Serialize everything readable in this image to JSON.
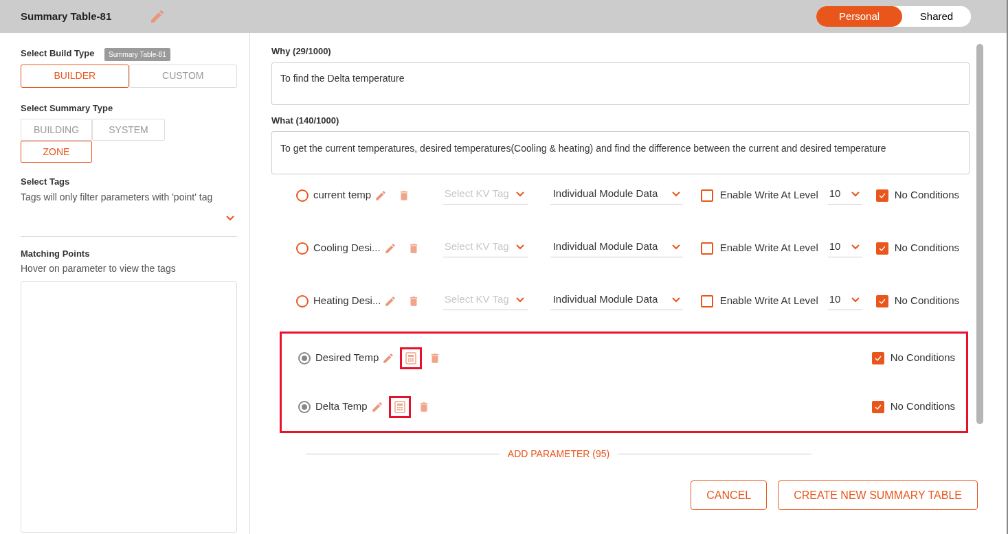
{
  "header": {
    "title": "Summary Table-81",
    "toggle": [
      {
        "label": "Personal",
        "selected": true
      },
      {
        "label": "Shared",
        "selected": false
      }
    ]
  },
  "tooltip": "Summary Table-81",
  "sidebar": {
    "build_type": {
      "label": "Select Build Type",
      "options": [
        {
          "label": "BUILDER",
          "selected": true
        },
        {
          "label": "CUSTOM",
          "selected": false
        }
      ]
    },
    "summary_type": {
      "label": "Select Summary Type",
      "options": [
        {
          "label": "BUILDING",
          "selected": false
        },
        {
          "label": "SYSTEM",
          "selected": false
        },
        {
          "label": "ZONE",
          "selected": true
        }
      ]
    },
    "tags": {
      "label": "Select Tags",
      "hint": "Tags will only filter parameters with 'point' tag"
    },
    "matching": {
      "label": "Matching Points",
      "hint": "Hover on parameter to view the tags"
    }
  },
  "why": {
    "label": "Why (29/1000)",
    "value": "To find the Delta temperature"
  },
  "what": {
    "label": "What (140/1000)",
    "value": "To get the current temperatures, desired temperatures(Cooling & heating) and find the difference between the current and desired temperature"
  },
  "parameters": [
    {
      "kind": "point",
      "selected": false,
      "name": "current temp",
      "kv_placeholder": "Select KV Tag",
      "module": "Individual Module Data",
      "enable_write": {
        "label": "Enable Write At Level",
        "checked": false
      },
      "level_value": "10",
      "no_conditions": {
        "label": "No Conditions",
        "checked": true
      }
    },
    {
      "kind": "point",
      "selected": false,
      "name": "Cooling Desi...",
      "kv_placeholder": "Select KV Tag",
      "module": "Individual Module Data",
      "enable_write": {
        "label": "Enable Write At Level",
        "checked": false
      },
      "level_value": "10",
      "no_conditions": {
        "label": "No Conditions",
        "checked": true
      }
    },
    {
      "kind": "point",
      "selected": false,
      "name": "Heating Desi...",
      "kv_placeholder": "Select KV Tag",
      "module": "Individual Module Data",
      "enable_write": {
        "label": "Enable Write At Level",
        "checked": false
      },
      "level_value": "10",
      "no_conditions": {
        "label": "No Conditions",
        "checked": true
      }
    },
    {
      "kind": "formula",
      "selected": true,
      "name": "Desired Temp",
      "highlighted": true,
      "no_conditions": {
        "label": "No Conditions",
        "checked": true
      }
    },
    {
      "kind": "formula",
      "selected": true,
      "name": "Delta Temp",
      "highlighted": true,
      "no_conditions": {
        "label": "No Conditions",
        "checked": true
      }
    }
  ],
  "add_parameter": "ADD PARAMETER (95)",
  "buttons": [
    {
      "label": "CANCEL"
    },
    {
      "label": "CREATE NEW SUMMARY TABLE"
    }
  ]
}
